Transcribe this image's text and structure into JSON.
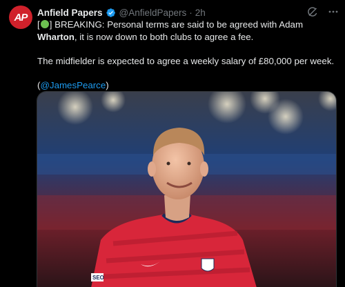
{
  "account": {
    "avatar_text": "AP",
    "display_name": "Anfield Papers",
    "handle": "@AnfieldPapers",
    "separator": "·",
    "time": "2h",
    "avatar_color": "#d0212b",
    "verified_color": "#1d9bf0"
  },
  "actions": {
    "grok_icon": "grok-icon",
    "more_icon": "more-icon"
  },
  "tweet": {
    "line1_prefix": "[",
    "line1_after_emoji": "] BREAKING: Personal terms are said to be agreed with Adam ",
    "line1_bold": "Wharton",
    "line1_suffix": ", it is now down to both clubs to agree a fee.",
    "line2": "The midfielder is expected to agree a weekly salary of £80,000 per week.",
    "line3_prefix": "(",
    "line3_link": "@JamesPearce",
    "line3_suffix": ")",
    "emoji": "green-circle"
  },
  "media": {
    "description_icon": "photo",
    "shirt_color": "#d8263a",
    "badge_text": "SEO"
  }
}
